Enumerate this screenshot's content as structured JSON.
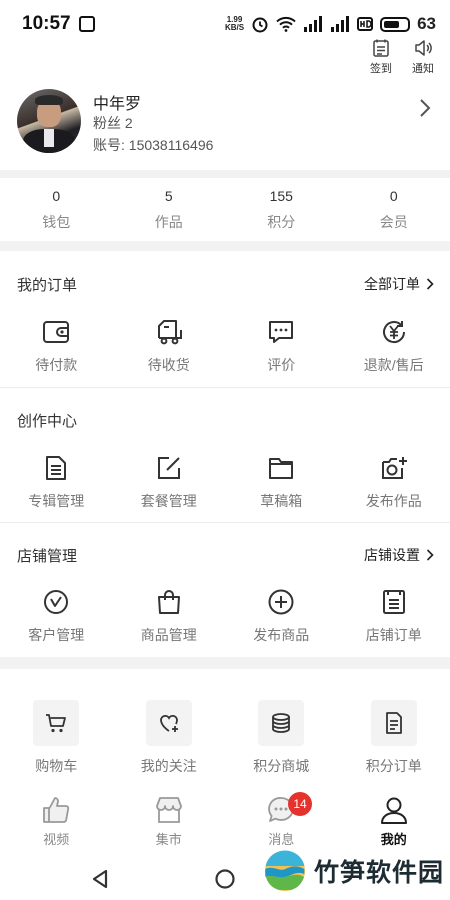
{
  "status_bar": {
    "time": "10:57",
    "net_speed_value": "1.99",
    "net_speed_unit": "KB/S",
    "battery_level": "63"
  },
  "top_actions": [
    {
      "label": "签到",
      "icon": "checkin-icon"
    },
    {
      "label": "通知",
      "icon": "speaker-icon"
    }
  ],
  "profile": {
    "name": "中年罗",
    "fans": "粉丝 2",
    "account": "账号: 15038116496"
  },
  "stats": [
    {
      "value": "0",
      "label": "钱包"
    },
    {
      "value": "5",
      "label": "作品"
    },
    {
      "value": "155",
      "label": "积分"
    },
    {
      "value": "0",
      "label": "会员"
    }
  ],
  "orders": {
    "title": "我的订单",
    "link": "全部订单",
    "items": [
      {
        "label": "待付款",
        "icon": "wallet-icon"
      },
      {
        "label": "待收货",
        "icon": "truck-icon"
      },
      {
        "label": "评价",
        "icon": "comment-icon"
      },
      {
        "label": "退款/售后",
        "icon": "refund-icon"
      }
    ]
  },
  "creation": {
    "title": "创作中心",
    "items": [
      {
        "label": "专辑管理",
        "icon": "album-icon"
      },
      {
        "label": "套餐管理",
        "icon": "edit-icon"
      },
      {
        "label": "草稿箱",
        "icon": "folder-icon"
      },
      {
        "label": "发布作品",
        "icon": "camera-plus-icon"
      }
    ]
  },
  "store": {
    "title": "店铺管理",
    "link": "店铺设置",
    "items": [
      {
        "label": "客户管理",
        "icon": "customer-icon"
      },
      {
        "label": "商品管理",
        "icon": "bag-icon"
      },
      {
        "label": "发布商品",
        "icon": "plus-circle-icon"
      },
      {
        "label": "店铺订单",
        "icon": "order-list-icon"
      }
    ]
  },
  "tools": [
    {
      "label": "购物车",
      "icon": "cart-icon"
    },
    {
      "label": "我的关注",
      "icon": "heart-plus-icon"
    },
    {
      "label": "积分商城",
      "icon": "coins-icon"
    },
    {
      "label": "积分订单",
      "icon": "document-icon"
    }
  ],
  "tabbar": [
    {
      "label": "视频",
      "icon": "thumbs-up-icon"
    },
    {
      "label": "集市",
      "icon": "shop-icon"
    },
    {
      "label": "消息",
      "icon": "chat-icon",
      "badge": "14"
    },
    {
      "label": "我的",
      "icon": "user-icon"
    }
  ],
  "watermark": "竹笋软件园",
  "colors": {
    "badge": "#e5322c",
    "divider": "#f2f2f2",
    "label_gray": "#777777"
  }
}
